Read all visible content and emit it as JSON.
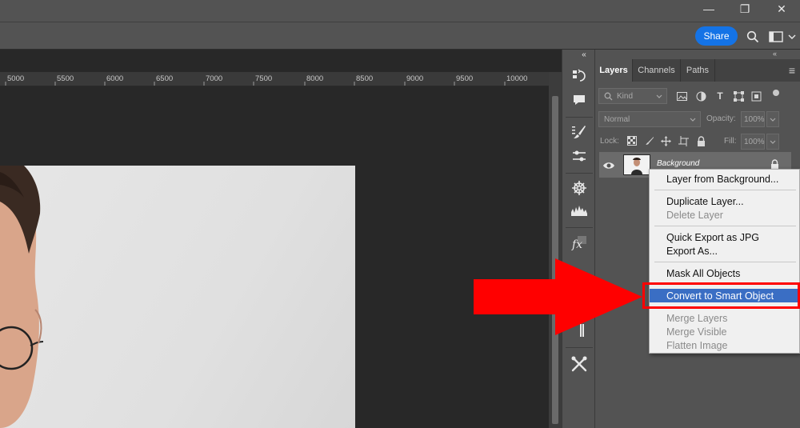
{
  "window": {
    "minimize_glyph": "—",
    "maximize_glyph": "❐",
    "close_glyph": "✕"
  },
  "toolbar": {
    "share_label": "Share"
  },
  "ruler": {
    "labels": [
      "5000",
      "5500",
      "6000",
      "6500",
      "7000",
      "7500",
      "8000",
      "8500",
      "9000",
      "9500",
      "10000"
    ]
  },
  "panel": {
    "tabs": [
      "Layers",
      "Channels",
      "Paths"
    ],
    "collapse_glyph": "«",
    "menu_glyph": "≡",
    "kind_label": "Kind",
    "blend_mode": "Normal",
    "opacity_label": "Opacity:",
    "opacity_value": "100%",
    "lock_label": "Lock:",
    "fill_label": "Fill:",
    "fill_value": "100%",
    "layer_name": "Background"
  },
  "context_menu": {
    "items": [
      {
        "label": "Layer from Background...",
        "enabled": true
      },
      {
        "label": "Duplicate Layer...",
        "enabled": true
      },
      {
        "label": "Delete Layer",
        "enabled": false
      },
      {
        "label": "Quick Export as JPG",
        "enabled": true
      },
      {
        "label": "Export As...",
        "enabled": true
      },
      {
        "label": "Mask All Objects",
        "enabled": true
      },
      {
        "label": "Convert to Smart Object",
        "enabled": true,
        "highlighted": true
      },
      {
        "label": "Merge Layers",
        "enabled": false
      },
      {
        "label": "Merge Visible",
        "enabled": false
      },
      {
        "label": "Flatten Image",
        "enabled": false
      }
    ]
  },
  "colors": {
    "accent": "#1473e6",
    "highlight": "#3a6ec4",
    "annotation_red": "#ff0000"
  }
}
